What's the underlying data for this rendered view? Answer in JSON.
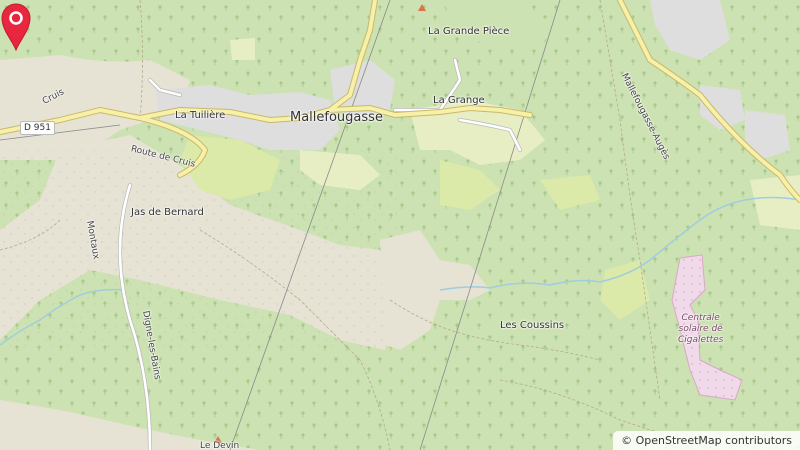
{
  "map": {
    "places": {
      "la_grande_piece": "La Grande Pièce",
      "la_grange": "La Grange",
      "mallefougasse": "Mallefougasse",
      "la_tuiliere": "La Tuilière",
      "cruis": "Cruis",
      "route_de_cruis": "Route de Cruis",
      "jas_de_bernard": "Jas de Bernard",
      "montaux": "Montaux",
      "digne_les_bains": "Digne-les-Bains",
      "les_coussins": "Les Coussins",
      "centrale_line1": "Centrale",
      "centrale_line2": "solaire de",
      "centrale_line3": "Cigalettes",
      "mallefougasse_auges": "Mallefougasse-Augès",
      "le_devin": "Le Devin"
    },
    "road_ref": "D 951",
    "attribution": "© OpenStreetMap contributors",
    "marker": {
      "color": "#e8263e",
      "icon": "map-pin-icon"
    },
    "colors": {
      "forest": "#cde2b2",
      "scrub": "#e6e3d5",
      "farmland": "#e8eec4",
      "grass": "#dbeaa9",
      "residential": "#dedede",
      "solar": "#f0d9e8",
      "water": "#9fcde0",
      "road_yellow": "#f6f0a8",
      "road_casing": "#c9b86a"
    }
  }
}
